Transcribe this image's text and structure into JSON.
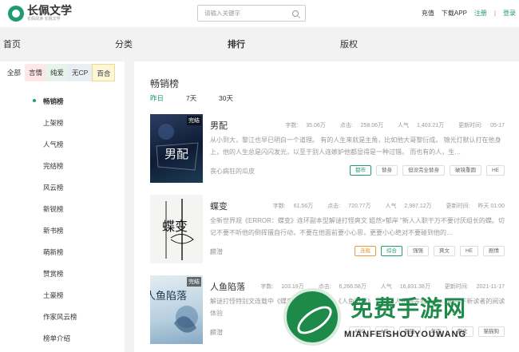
{
  "header": {
    "logo_title": "长佩文学",
    "logo_sub": "长佩阅读·长佩文学",
    "search_placeholder": "请输入关键字",
    "links": {
      "recharge": "充值",
      "download": "下载APP",
      "register": "注册",
      "sep": "|",
      "login": "登录"
    }
  },
  "nav": {
    "items": [
      "首页",
      "分类",
      "排行",
      "版权"
    ],
    "active": "排行"
  },
  "sidebar": {
    "categories": [
      "全部",
      "言情",
      "纯爱",
      "无CP",
      "百合"
    ],
    "ranks": [
      "畅销榜",
      "上架榜",
      "人气榜",
      "完结榜",
      "风云榜",
      "新锐榜",
      "新书榜",
      "萌新榜",
      "赞赏榜",
      "土豪榜",
      "作家风云榜",
      "榜单介绍"
    ],
    "active_rank": "畅销榜"
  },
  "main": {
    "title": "畅销榜",
    "time_tabs": [
      "昨日",
      "7天",
      "30天"
    ],
    "active_time": "昨日",
    "books": [
      {
        "title": "男配",
        "badge": "完结",
        "cover_text": "男配",
        "words_label": "字数:",
        "words": "35.06万",
        "clicks_label": "点击:",
        "clicks": "258.06万",
        "popularity_label": "人气",
        "popularity": "1,403.21万",
        "updated_label": "更新时间:",
        "updated": "05-17",
        "desc": "从小到大，黎江也早已明白一个道理。 有的人生来就是主角，比如他大哥黎衍成。 锦光灯默认打在他身上，他的人生总是闪闪发光，以至于别人连嫉妒他都显得是一种过错。 而也有的人，生…",
        "author": "丧心病狂的瓜皮",
        "tags": [
          "都市",
          "替身",
          "但没完全替身",
          "破镜重圆",
          "HE"
        ]
      },
      {
        "title": "蝶变",
        "badge": "",
        "cover_text": "蝶变",
        "words_label": "字数:",
        "words": "61.56万",
        "clicks_label": "点击:",
        "clicks": "720.77万",
        "popularity_label": "人气",
        "popularity": "2,987.12万",
        "updated_label": "更新时间:",
        "updated": "昨天 01:00",
        "desc": "全新世界观《ERROR：蝶变》连环副本型解谜打怪爽文 姐然×郁岸 \"新人人职干万不要讨厌组长的蝶。切记不要不听他的倒挥擅自行动，不要在他面前要小心思，更要小心绝对不要碰到他的…",
        "author": "麟潜",
        "tags": [
          "连载",
          "综合",
          "强强",
          "爽文",
          "HE",
          "剧情"
        ]
      },
      {
        "title": "人鱼陷落",
        "badge": "完结",
        "cover_text": "人鱼陷落",
        "words_label": "字数:",
        "words": "103.19万",
        "clicks_label": "点击:",
        "clicks": "6,266.58万",
        "popularity_label": "人气",
        "popularity": "16,831.38万",
        "updated_label": "更新时间:",
        "updated": "2021-11-17",
        "desc": "解谜打怪特别文连载中《蝶变》ID：165331 《人鱼陷落》 与海鱼人相遇等地人类… 顺—下新读者的阅读体验",
        "author": "麟潜",
        "tags": [
          "ABO",
          "HE",
          "强强",
          "年下",
          "爽文",
          "猫猫狗"
        ]
      }
    ]
  },
  "watermark": {
    "title": "免费手游网",
    "sub": "MIANFEISHOUYOUWANG"
  },
  "colors": {
    "accent": "#1e9a75"
  }
}
